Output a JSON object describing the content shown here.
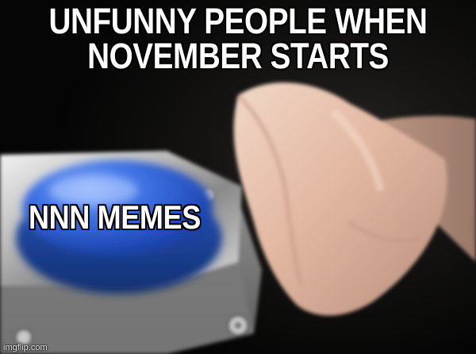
{
  "meme": {
    "template": "blank-nut-button",
    "top_text_line_1": "UNFUNNY PEOPLE WHEN",
    "top_text_line_2": "NOVEMBER STARTS",
    "button_label": "NNN MEMES",
    "watermark": "imgflip.com"
  },
  "colors": {
    "background": "#0b0b0b",
    "button_blue": "#2f62d6",
    "caption_text": "#ffffff",
    "caption_outline": "#000000"
  }
}
